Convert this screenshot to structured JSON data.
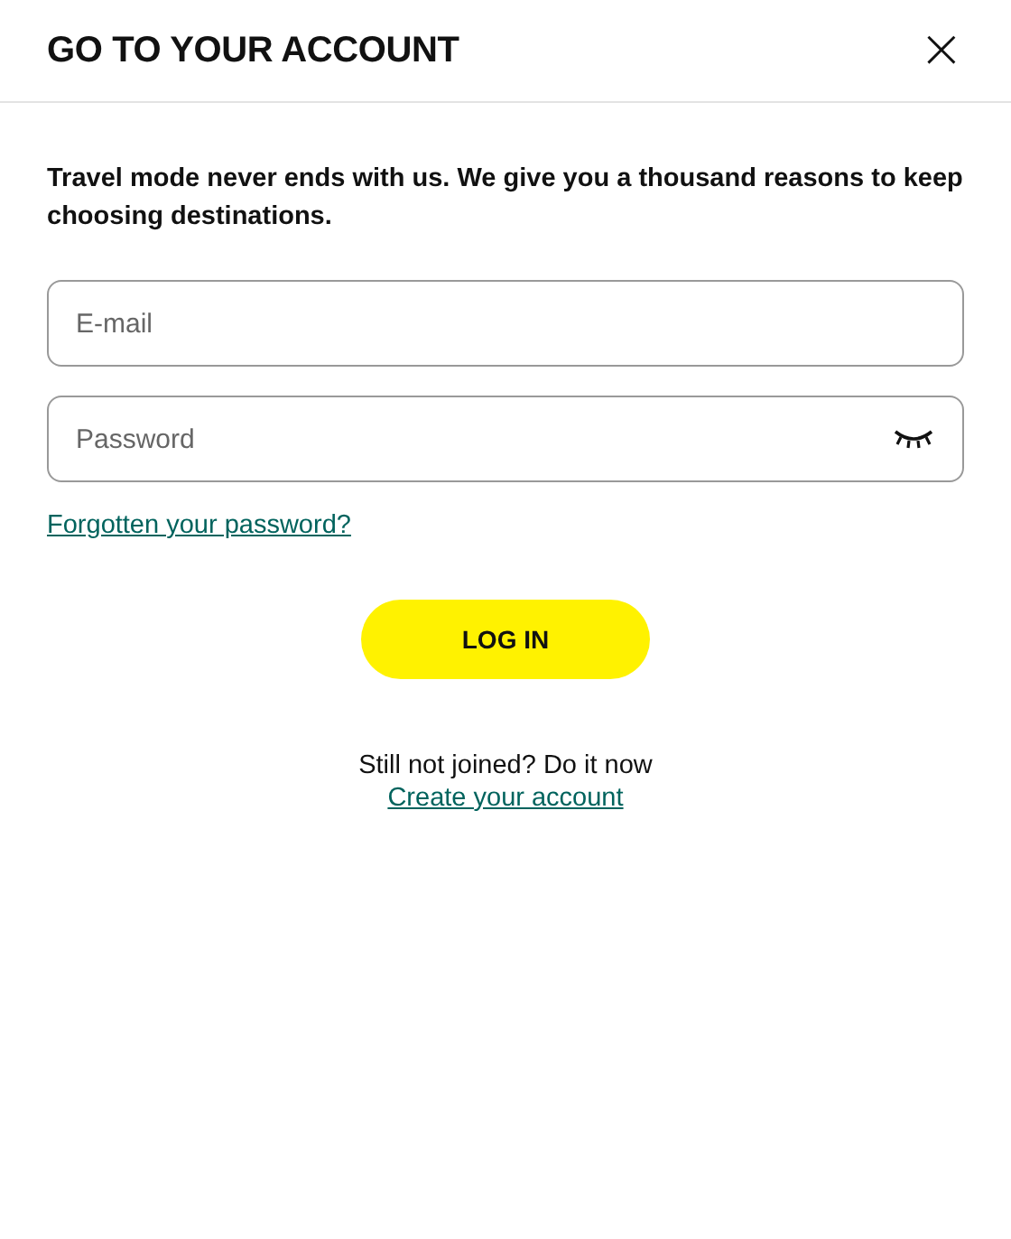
{
  "dialog": {
    "title": "GO TO YOUR ACCOUNT",
    "close": "×"
  },
  "intro": "Travel mode never ends with us. We give you a thousand reasons to keep choosing destinations.",
  "fields": [
    {
      "kind": "text",
      "placeholder": "E-mail"
    },
    {
      "kind": "password",
      "placeholder": "Password"
    }
  ],
  "forgot_link": "Forgotten your password?",
  "login_button": "LOG IN",
  "signup_prompt": "Still not joined? Do it now",
  "signup_link": "Create your account"
}
